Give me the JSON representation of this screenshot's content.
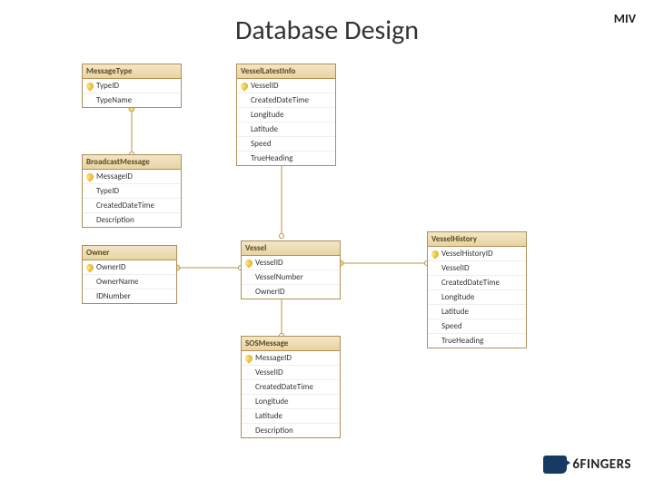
{
  "title": "Database Design",
  "corner_label": "MIV",
  "logo": {
    "brand": "6FINGERS"
  },
  "tables": {
    "message_type": {
      "name": "MessageType",
      "columns": [
        {
          "name": "TypeID",
          "pk": true
        },
        {
          "name": "TypeName",
          "pk": false
        }
      ]
    },
    "broadcast_message": {
      "name": "BroadcastMessage",
      "columns": [
        {
          "name": "MessageID",
          "pk": true
        },
        {
          "name": "TypeID",
          "pk": false
        },
        {
          "name": "CreatedDateTime",
          "pk": false
        },
        {
          "name": "Description",
          "pk": false
        }
      ]
    },
    "owner": {
      "name": "Owner",
      "columns": [
        {
          "name": "OwnerID",
          "pk": true
        },
        {
          "name": "OwnerName",
          "pk": false
        },
        {
          "name": "IDNumber",
          "pk": false
        }
      ]
    },
    "vessel_latest_info": {
      "name": "VesselLatestInfo",
      "columns": [
        {
          "name": "VesselID",
          "pk": true
        },
        {
          "name": "CreatedDateTime",
          "pk": false
        },
        {
          "name": "Longitude",
          "pk": false
        },
        {
          "name": "Latitude",
          "pk": false
        },
        {
          "name": "Speed",
          "pk": false
        },
        {
          "name": "TrueHeading",
          "pk": false
        }
      ]
    },
    "vessel": {
      "name": "Vessel",
      "columns": [
        {
          "name": "VesselID",
          "pk": true
        },
        {
          "name": "VesselNumber",
          "pk": false
        },
        {
          "name": "OwnerID",
          "pk": false
        }
      ]
    },
    "vessel_history": {
      "name": "VesselHistory",
      "columns": [
        {
          "name": "VesselHistoryID",
          "pk": true
        },
        {
          "name": "VesselID",
          "pk": false
        },
        {
          "name": "CreatedDateTime",
          "pk": false
        },
        {
          "name": "Longitude",
          "pk": false
        },
        {
          "name": "Latitude",
          "pk": false
        },
        {
          "name": "Speed",
          "pk": false
        },
        {
          "name": "TrueHeading",
          "pk": false
        }
      ]
    },
    "sos_message": {
      "name": "SOSMessage",
      "columns": [
        {
          "name": "MessageID",
          "pk": true
        },
        {
          "name": "VesselID",
          "pk": false
        },
        {
          "name": "CreatedDateTime",
          "pk": false
        },
        {
          "name": "Longitude",
          "pk": false
        },
        {
          "name": "Latitude",
          "pk": false
        },
        {
          "name": "Description",
          "pk": false
        }
      ]
    }
  },
  "relations": [
    {
      "from": "message_type",
      "to": "broadcast_message"
    },
    {
      "from": "vessel_latest_info",
      "to": "vessel"
    },
    {
      "from": "owner",
      "to": "vessel"
    },
    {
      "from": "vessel",
      "to": "vessel_history"
    },
    {
      "from": "vessel",
      "to": "sos_message"
    }
  ]
}
